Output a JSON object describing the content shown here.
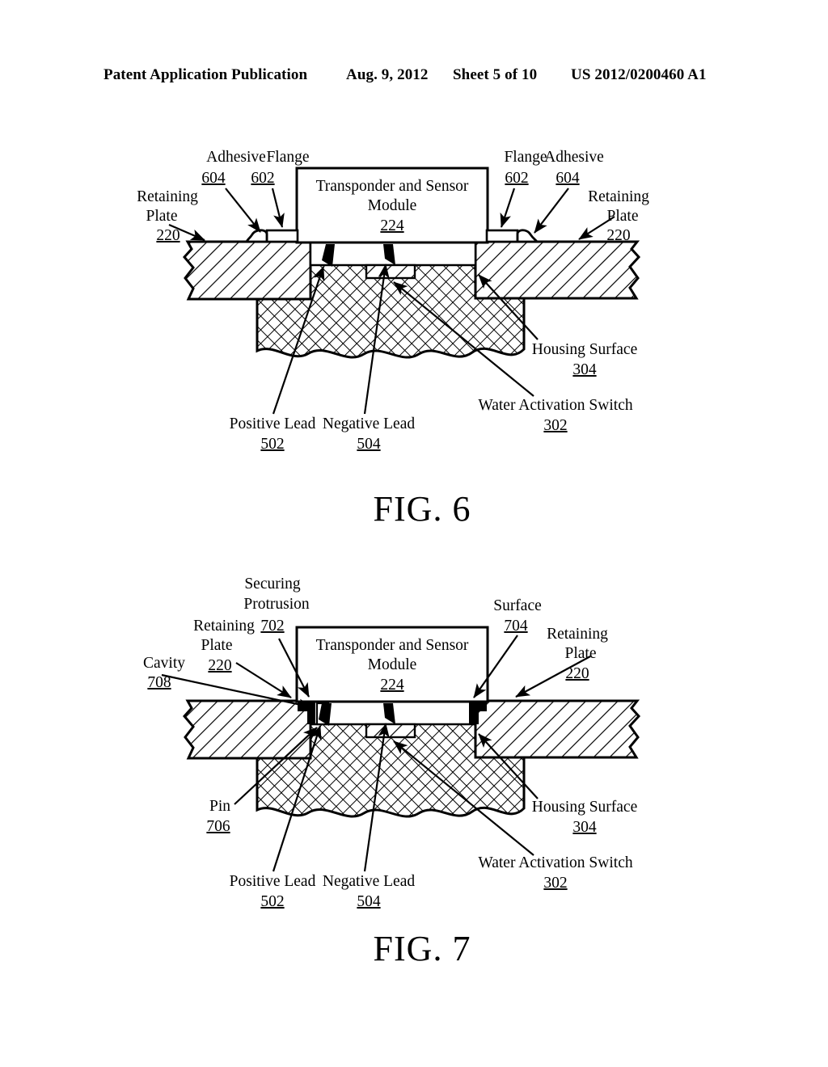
{
  "header": {
    "publication": "Patent Application Publication",
    "date": "Aug. 9, 2012",
    "sheet": "Sheet 5 of 10",
    "number": "US 2012/0200460 A1"
  },
  "figures": [
    {
      "id": "fig6",
      "caption": "FIG. 6",
      "module": {
        "line1": "Transponder and Sensor",
        "line2": "Module",
        "ref": "224"
      },
      "labels": [
        {
          "name": "adhesive-left",
          "text": "Adhesive",
          "ref": "604"
        },
        {
          "name": "flange-left",
          "text": "Flange",
          "ref": "602"
        },
        {
          "name": "retaining-plate-left",
          "text_line1": "Retaining",
          "text_line2": "Plate",
          "ref": "220"
        },
        {
          "name": "flange-right",
          "text": "Flange",
          "ref": "602"
        },
        {
          "name": "adhesive-right",
          "text": "Adhesive",
          "ref": "604"
        },
        {
          "name": "retaining-plate-right",
          "text_line1": "Retaining",
          "text_line2": "Plate",
          "ref": "220"
        },
        {
          "name": "housing-surface",
          "text": "Housing Surface",
          "ref": "304"
        },
        {
          "name": "water-activation-switch",
          "text": "Water Activation Switch",
          "ref": "302"
        },
        {
          "name": "positive-lead",
          "text": "Positive Lead",
          "ref": "502"
        },
        {
          "name": "negative-lead",
          "text": "Negative Lead",
          "ref": "504"
        }
      ]
    },
    {
      "id": "fig7",
      "caption": "FIG. 7",
      "module": {
        "line1": "Transponder and Sensor",
        "line2": "Module",
        "ref": "224"
      },
      "labels": [
        {
          "name": "securing-protrusion",
          "text_line1": "Securing",
          "text_line2": "Protrusion",
          "ref": "702"
        },
        {
          "name": "retaining-plate-left",
          "text_line1": "Retaining",
          "text_line2": "Plate",
          "ref": "220"
        },
        {
          "name": "cavity",
          "text": "Cavity",
          "ref": "708"
        },
        {
          "name": "surface",
          "text": "Surface",
          "ref": "704"
        },
        {
          "name": "retaining-plate-right",
          "text_line1": "Retaining",
          "text_line2": "Plate",
          "ref": "220"
        },
        {
          "name": "pin",
          "text": "Pin",
          "ref": "706"
        },
        {
          "name": "housing-surface",
          "text": "Housing Surface",
          "ref": "304"
        },
        {
          "name": "water-activation-switch",
          "text": "Water Activation Switch",
          "ref": "302"
        },
        {
          "name": "positive-lead",
          "text": "Positive Lead",
          "ref": "502"
        },
        {
          "name": "negative-lead",
          "text": "Negative Lead",
          "ref": "504"
        }
      ]
    }
  ],
  "text": {
    "fig6": {
      "adhesive_left": "Adhesive",
      "flange_left": "Flange",
      "num_604_left": "604",
      "num_602_left": "602",
      "retaining_left_1": "Retaining",
      "retaining_left_2": "Plate",
      "num_220_left": "220",
      "flange_right": "Flange",
      "adhesive_right": "Adhesive",
      "num_602_right": "602",
      "num_604_right": "604",
      "retaining_right_1": "Retaining",
      "retaining_right_2": "Plate",
      "num_220_right": "220",
      "module_1": "Transponder and Sensor",
      "module_2": "Module",
      "module_ref": "224",
      "housing_surface": "Housing Surface",
      "num_304": "304",
      "water_switch": "Water Activation Switch",
      "num_302": "302",
      "positive_lead": "Positive Lead",
      "num_502": "502",
      "negative_lead": "Negative Lead",
      "num_504": "504",
      "caption": "FIG. 6"
    },
    "fig7": {
      "securing_1": "Securing",
      "securing_2": "Protrusion",
      "num_702": "702",
      "retaining_left_1": "Retaining",
      "retaining_left_2": "Plate",
      "num_220_left": "220",
      "cavity": "Cavity",
      "num_708": "708",
      "surface": "Surface",
      "num_704": "704",
      "retaining_right_1": "Retaining",
      "retaining_right_2": "Plate",
      "num_220_right": "220",
      "module_1": "Transponder and Sensor",
      "module_2": "Module",
      "module_ref": "224",
      "pin": "Pin",
      "num_706": "706",
      "housing_surface": "Housing Surface",
      "num_304": "304",
      "water_switch": "Water Activation Switch",
      "num_302": "302",
      "positive_lead": "Positive Lead",
      "num_502": "502",
      "negative_lead": "Negative Lead",
      "num_504": "504",
      "caption": "FIG. 7"
    }
  }
}
